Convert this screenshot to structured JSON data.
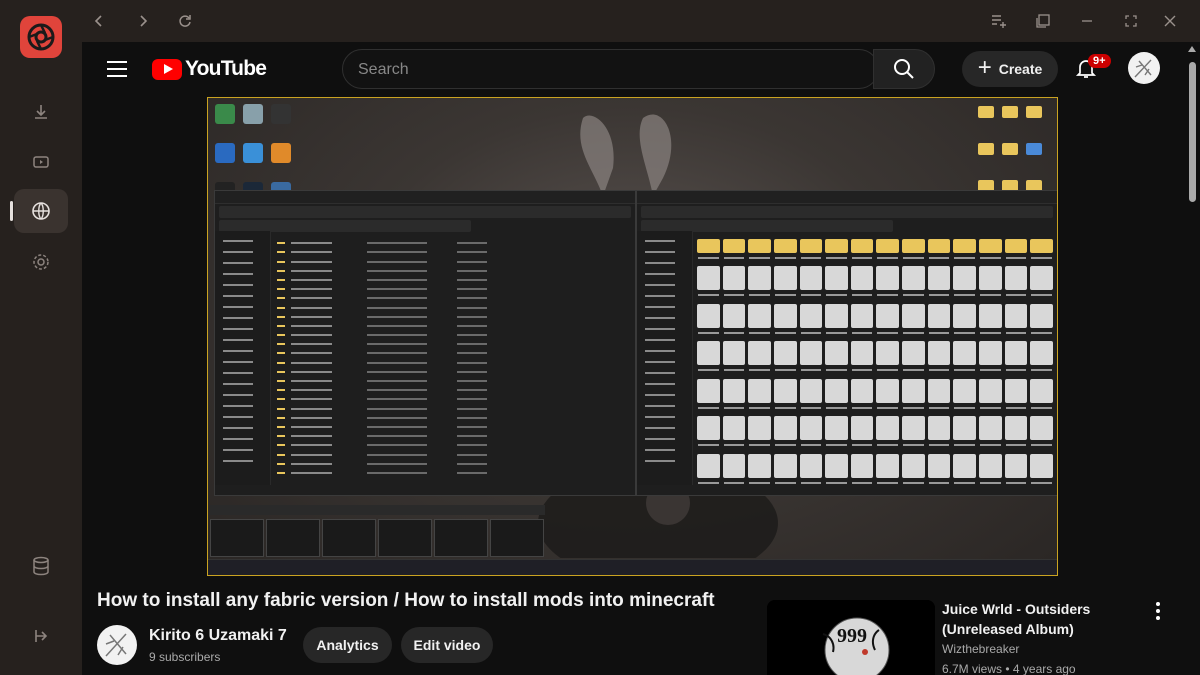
{
  "app": {
    "rail_items": [
      "download-icon",
      "video-icon",
      "globe-icon",
      "settings-icon",
      "database-icon",
      "logout-icon"
    ],
    "active_item": "globe-icon"
  },
  "browser": {
    "nav_icons": [
      "back-icon",
      "forward-icon",
      "reload-icon"
    ],
    "window_icons": [
      "playlist-add-icon",
      "tabs-icon",
      "minimize-icon",
      "maximize-icon",
      "close-icon"
    ]
  },
  "youtube": {
    "logo_text": "YouTube",
    "search_placeholder": "Search",
    "create_label": "Create",
    "notification_badge": "9+"
  },
  "video": {
    "title": "How to install any fabric version / How to install mods into minecraft",
    "channel_name": "Kirito 6 Uzamaki 7",
    "subscribers": "9 subscribers",
    "analytics_label": "Analytics",
    "edit_label": "Edit video"
  },
  "suggested": {
    "title": "Juice Wrld - Outsiders (Unreleased Album)",
    "channel": "Wizthebreaker",
    "meta": "6.7M views • 4 years ago",
    "thumb_text": "999"
  },
  "colors": {
    "accent_red": "#ff0000",
    "app_logo": "#e0443b",
    "badge": "#cc0000",
    "video_border": "#caa321"
  }
}
